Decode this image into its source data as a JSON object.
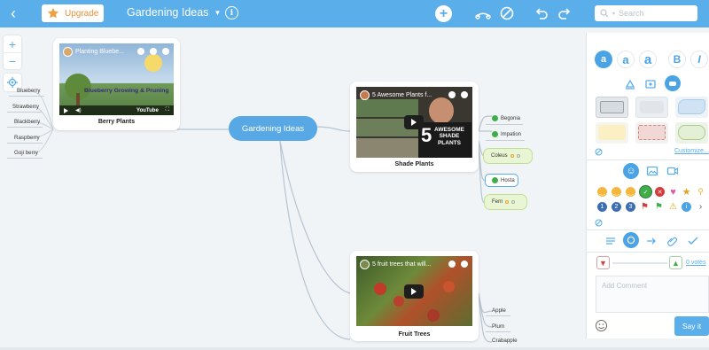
{
  "topbar": {
    "upgrade_label": "Upgrade",
    "map_title": "Gardening Ideas",
    "search_placeholder": "Search"
  },
  "map": {
    "central": "Gardening Ideas",
    "berry": {
      "label": "Berry Plants",
      "video_title": "Planting Bluebe...",
      "video_overlay": "Blueberry Growing & Pruning",
      "video_brand": "YouTube",
      "children": [
        "Blueberry",
        "Strawberry",
        "Blackberry",
        "Raspberry",
        "Goji berry"
      ]
    },
    "shade": {
      "label": "Shade Plants",
      "video_title": "5 Awesome Plants f...",
      "thumb_text": [
        "5",
        "AWESOME",
        "SHADE",
        "PLANTS"
      ],
      "children": [
        "Begonia",
        "Impation",
        "Coleus",
        "Hosta",
        "Fern"
      ]
    },
    "fruit": {
      "label": "Fruit Trees",
      "video_title": "5 fruit trees that will...",
      "children": [
        "Apple",
        "Plum",
        "Crabapple"
      ]
    }
  },
  "panel": {
    "font_buttons": [
      "a",
      "a",
      "a",
      "B",
      "I"
    ],
    "customize_label": "Customize...",
    "votes_label": "0 votes",
    "comment_placeholder": "Add Comment",
    "say_it_label": "Say it",
    "priority_numbers": [
      "1",
      "2",
      "3"
    ]
  },
  "colors": {
    "accent": "#5aaeea",
    "topbar": "#5aaeea",
    "central_node": "#58a8e6",
    "cloud_fill": "#e9f6d4"
  }
}
